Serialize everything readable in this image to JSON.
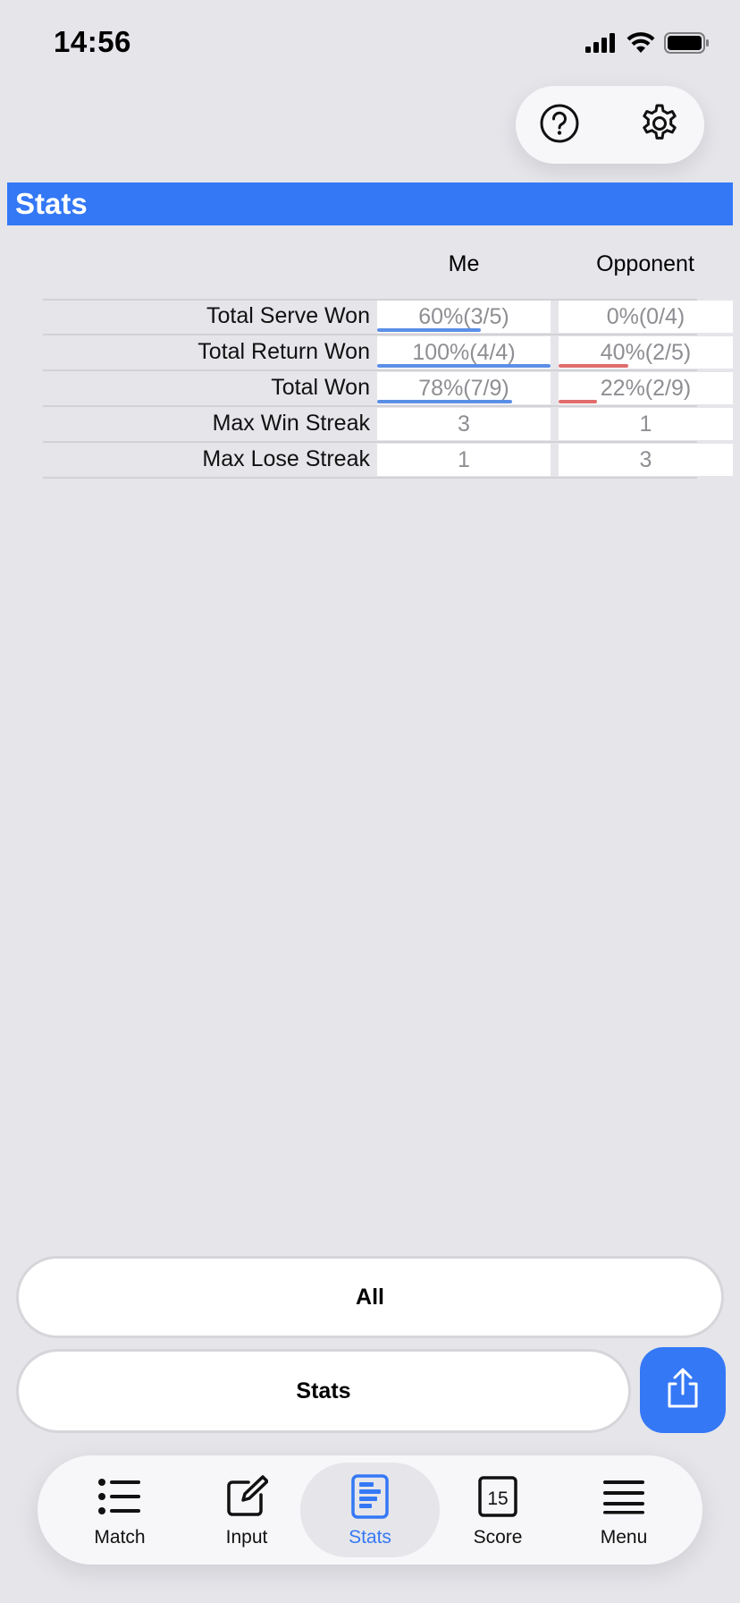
{
  "status_bar": {
    "time": "14:56"
  },
  "header": {
    "title": "Stats"
  },
  "table": {
    "columns": [
      "Me",
      "Opponent"
    ],
    "rows": [
      {
        "label": "Total Serve Won",
        "me": "60%(3/5)",
        "opponent": "0%(0/4)",
        "me_fraction": 0.6,
        "opponent_fraction": 0.0
      },
      {
        "label": "Total Return Won",
        "me": "100%(4/4)",
        "opponent": "40%(2/5)",
        "me_fraction": 1.0,
        "opponent_fraction": 0.4
      },
      {
        "label": "Total Won",
        "me": "78%(7/9)",
        "opponent": "22%(2/9)",
        "me_fraction": 0.78,
        "opponent_fraction": 0.22
      },
      {
        "label": "Max Win Streak",
        "me": "3",
        "opponent": "1"
      },
      {
        "label": "Max Lose Streak",
        "me": "1",
        "opponent": "3"
      }
    ]
  },
  "filters": {
    "all_label": "All",
    "stats_label": "Stats"
  },
  "tabs": [
    {
      "label": "Match",
      "icon": "list-icon"
    },
    {
      "label": "Input",
      "icon": "edit-icon"
    },
    {
      "label": "Stats",
      "icon": "stats-doc-icon",
      "active": true
    },
    {
      "label": "Score",
      "icon": "calendar-15-icon",
      "badge": "15"
    },
    {
      "label": "Menu",
      "icon": "hamburger-icon"
    }
  ],
  "colors": {
    "accent": "#3478f6",
    "me_bar": "#5b8fe6",
    "opponent_bar": "#e06c6c",
    "background": "#e5e5ea"
  }
}
